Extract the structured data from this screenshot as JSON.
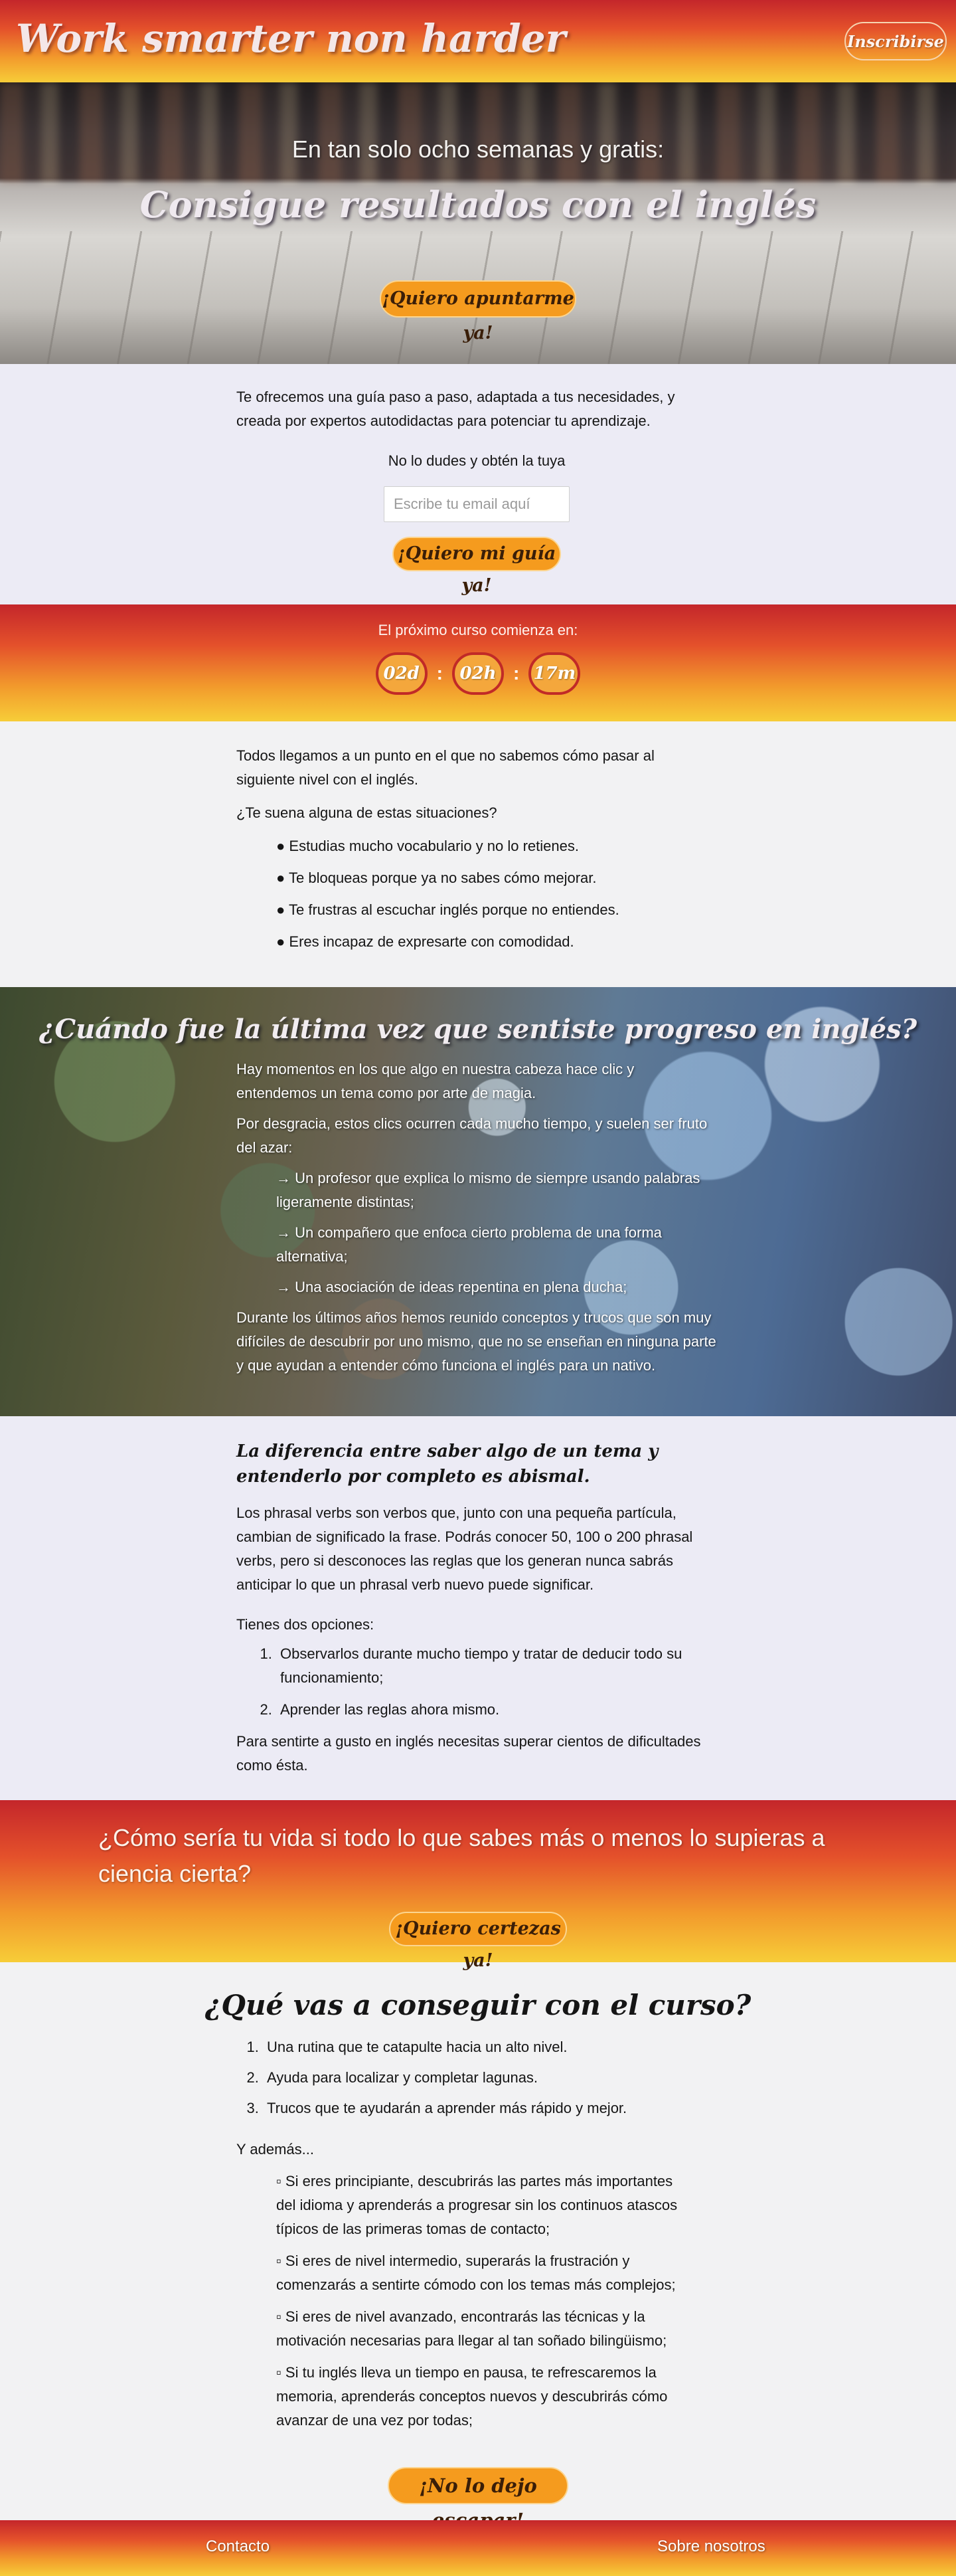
{
  "header": {
    "brand": "Work smarter non harder",
    "signup_button": "Inscribirse"
  },
  "hero": {
    "subtitle": "En tan solo ocho semanas y gratis:",
    "title": "Consigue resultados con el inglés",
    "cta": "¡Quiero apuntarme ya!"
  },
  "intro": {
    "text": "Te ofrecemos una guía paso a paso, adaptada a tus necesidades, y creada por expertos autodidactas para potenciar tu aprendizaje.",
    "prompt": "No lo dudes y obtén la tuya",
    "email_placeholder": "Escribe tu email aquí",
    "email_value": "",
    "cta": "¡Quiero mi guía ya!"
  },
  "countdown": {
    "label": "El próximo curso comienza en:",
    "days": "02d",
    "hours": "02h",
    "minutes": "17m",
    "separator": ":"
  },
  "situations": {
    "intro": "Todos llegamos a un punto en el que no sabemos cómo pasar al siguiente nivel con el inglés.",
    "question": "¿Te suena alguna de estas situaciones?",
    "items": [
      "● Estudias mucho vocabulario y no lo retienes.",
      "● Te bloqueas porque ya no sabes cómo mejorar.",
      "● Te frustras al escuchar inglés porque no entiendes.",
      "● Eres incapaz de expresarte con comodidad."
    ]
  },
  "progress": {
    "title": "¿Cuándo fue la última vez que sentiste progreso en inglés?",
    "p1": "Hay momentos en los que algo en nuestra cabeza hace clic y entendemos un tema como por arte de magia.",
    "p2": "Por desgracia, estos clics ocurren cada mucho tiempo, y suelen ser fruto del azar:",
    "items": [
      "→ Un profesor que explica lo mismo de siempre usando palabras ligeramente distintas;",
      "→ Un compañero que enfoca cierto problema de una forma alternativa;",
      "→ Una asociación de ideas repentina en plena ducha;"
    ],
    "p3": "Durante los últimos años hemos reunido conceptos y trucos que son muy difíciles de descubrir por uno mismo, que no se enseñan en ninguna parte y que ayudan a entender cómo funciona el inglés para un nativo."
  },
  "difference": {
    "heading": "La diferencia entre saber algo de un tema y entenderlo por completo es abismal.",
    "p1": "Los phrasal verbs son verbos que, junto con una pequeña partícula, cambian de significado la frase. Podrás conocer 50, 100 o 200 phrasal verbs, pero si desconoces las reglas que los generan nunca sabrás anticipar lo que un phrasal verb nuevo puede significar.",
    "p2": "Tienes dos opciones:",
    "options": [
      "Observarlos durante mucho tiempo y tratar de deducir todo su funcionamiento;",
      "Aprender las reglas ahora mismo."
    ],
    "p3": "Para sentirte a gusto en inglés necesitas superar cientos de dificultades como ésta."
  },
  "question_band": {
    "text": "¿Cómo sería tu vida si todo lo que sabes más o menos lo supieras a ciencia cierta?",
    "cta": "¡Quiero certezas ya!"
  },
  "course": {
    "heading": "¿Qué vas a conseguir con el curso?",
    "goals": [
      "Una rutina que te catapulte hacia un alto nivel.",
      "Ayuda para localizar y completar lagunas.",
      "Trucos que te ayudarán a aprender más rápido y mejor."
    ],
    "also": "Y además...",
    "levels": [
      "▫ Si eres principiante, descubrirás las partes más importantes del idioma y aprenderás a progresar sin los continuos atascos típicos de las primeras tomas de contacto;",
      "▫ Si eres de nivel intermedio, superarás la frustración y comenzarás a sentirte cómodo con los temas más complejos;",
      "▫ Si eres de nivel avanzado, encontrarás las técnicas y la motivación necesarias para llegar al tan soñado bilingüismo;",
      "▫ Si tu inglés lleva un tiempo en pausa, te refrescaremos la memoria, aprenderás conceptos nuevos y descubrirás cómo avanzar de una vez por todas;"
    ],
    "cta": "¡No lo dejo escapar!"
  },
  "footer": {
    "contact": "Contacto",
    "about": "Sobre nosotros"
  },
  "colors": {
    "gradient_top": "#c4262b",
    "gradient_bottom": "#f7cd38",
    "button_orange": "#f59b1e",
    "page_background": "#f2f2f4"
  }
}
